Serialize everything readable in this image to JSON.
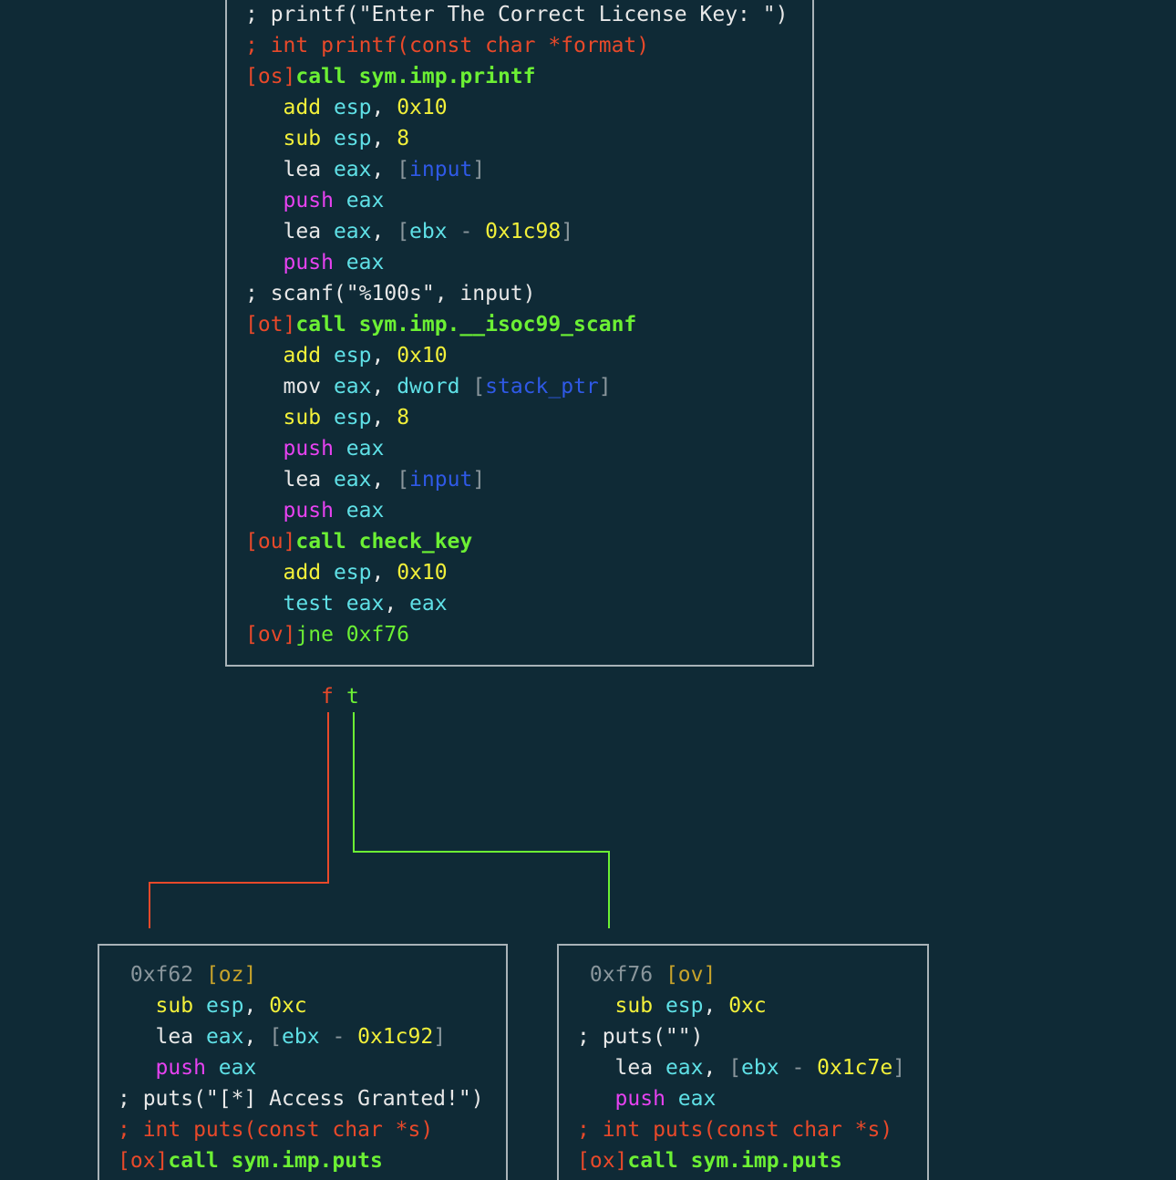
{
  "top_block": {
    "lines": [
      [
        {
          "t": "; printf(\"Enter The Correct License Key: \")",
          "c": "white"
        }
      ],
      [
        {
          "t": "; int printf(const char *format)",
          "c": "red"
        }
      ],
      [
        {
          "t": "[os]",
          "c": "red"
        },
        {
          "t": "call sym.imp.printf",
          "c": "green",
          "b": true
        }
      ],
      [
        {
          "t": "   add ",
          "c": "yellow"
        },
        {
          "t": "esp",
          "c": "cyan"
        },
        {
          "t": ", ",
          "c": "white"
        },
        {
          "t": "0x10",
          "c": "yellow"
        }
      ],
      [
        {
          "t": "   sub ",
          "c": "yellow"
        },
        {
          "t": "esp",
          "c": "cyan"
        },
        {
          "t": ", ",
          "c": "white"
        },
        {
          "t": "8",
          "c": "yellow"
        }
      ],
      [
        {
          "t": "   lea ",
          "c": "white"
        },
        {
          "t": "eax",
          "c": "cyan"
        },
        {
          "t": ", ",
          "c": "white"
        },
        {
          "t": "[",
          "c": "gray"
        },
        {
          "t": "input",
          "c": "blue"
        },
        {
          "t": "]",
          "c": "gray"
        }
      ],
      [
        {
          "t": "   push ",
          "c": "magenta"
        },
        {
          "t": "eax",
          "c": "cyan"
        }
      ],
      [
        {
          "t": "   lea ",
          "c": "white"
        },
        {
          "t": "eax",
          "c": "cyan"
        },
        {
          "t": ", ",
          "c": "white"
        },
        {
          "t": "[",
          "c": "gray"
        },
        {
          "t": "ebx",
          "c": "cyan"
        },
        {
          "t": " - ",
          "c": "gray"
        },
        {
          "t": "0x1c98",
          "c": "yellow"
        },
        {
          "t": "]",
          "c": "gray"
        }
      ],
      [
        {
          "t": "   push ",
          "c": "magenta"
        },
        {
          "t": "eax",
          "c": "cyan"
        }
      ],
      [
        {
          "t": "; scanf(\"%100s\", input)",
          "c": "white"
        }
      ],
      [
        {
          "t": "[ot]",
          "c": "red"
        },
        {
          "t": "call sym.imp.__isoc99_scanf",
          "c": "green",
          "b": true
        }
      ],
      [
        {
          "t": "   add ",
          "c": "yellow"
        },
        {
          "t": "esp",
          "c": "cyan"
        },
        {
          "t": ", ",
          "c": "white"
        },
        {
          "t": "0x10",
          "c": "yellow"
        }
      ],
      [
        {
          "t": "   mov ",
          "c": "white"
        },
        {
          "t": "eax",
          "c": "cyan"
        },
        {
          "t": ", ",
          "c": "white"
        },
        {
          "t": "dword ",
          "c": "cyan"
        },
        {
          "t": "[",
          "c": "gray"
        },
        {
          "t": "stack_ptr",
          "c": "blue"
        },
        {
          "t": "]",
          "c": "gray"
        }
      ],
      [
        {
          "t": "   sub ",
          "c": "yellow"
        },
        {
          "t": "esp",
          "c": "cyan"
        },
        {
          "t": ", ",
          "c": "white"
        },
        {
          "t": "8",
          "c": "yellow"
        }
      ],
      [
        {
          "t": "   push ",
          "c": "magenta"
        },
        {
          "t": "eax",
          "c": "cyan"
        }
      ],
      [
        {
          "t": "   lea ",
          "c": "white"
        },
        {
          "t": "eax",
          "c": "cyan"
        },
        {
          "t": ", ",
          "c": "white"
        },
        {
          "t": "[",
          "c": "gray"
        },
        {
          "t": "input",
          "c": "blue"
        },
        {
          "t": "]",
          "c": "gray"
        }
      ],
      [
        {
          "t": "   push ",
          "c": "magenta"
        },
        {
          "t": "eax",
          "c": "cyan"
        }
      ],
      [
        {
          "t": "[ou]",
          "c": "red"
        },
        {
          "t": "call check_key",
          "c": "green",
          "b": true
        }
      ],
      [
        {
          "t": "   add ",
          "c": "yellow"
        },
        {
          "t": "esp",
          "c": "cyan"
        },
        {
          "t": ", ",
          "c": "white"
        },
        {
          "t": "0x10",
          "c": "yellow"
        }
      ],
      [
        {
          "t": "   test ",
          "c": "cyan"
        },
        {
          "t": "eax",
          "c": "cyan"
        },
        {
          "t": ", ",
          "c": "white"
        },
        {
          "t": "eax",
          "c": "cyan"
        }
      ],
      [
        {
          "t": "[ov]",
          "c": "red"
        },
        {
          "t": "jne 0xf76",
          "c": "green"
        }
      ]
    ]
  },
  "edge_labels": {
    "false_label": "f",
    "true_label": "t"
  },
  "left_block": {
    "lines": [
      [
        {
          "t": " 0xf62 ",
          "c": "gray"
        },
        {
          "t": "[oz]",
          "c": "gold"
        }
      ],
      [
        {
          "t": "   sub ",
          "c": "yellow"
        },
        {
          "t": "esp",
          "c": "cyan"
        },
        {
          "t": ", ",
          "c": "white"
        },
        {
          "t": "0xc",
          "c": "yellow"
        }
      ],
      [
        {
          "t": "   lea ",
          "c": "white"
        },
        {
          "t": "eax",
          "c": "cyan"
        },
        {
          "t": ", ",
          "c": "white"
        },
        {
          "t": "[",
          "c": "gray"
        },
        {
          "t": "ebx",
          "c": "cyan"
        },
        {
          "t": " - ",
          "c": "gray"
        },
        {
          "t": "0x1c92",
          "c": "yellow"
        },
        {
          "t": "]",
          "c": "gray"
        }
      ],
      [
        {
          "t": "   push ",
          "c": "magenta"
        },
        {
          "t": "eax",
          "c": "cyan"
        }
      ],
      [
        {
          "t": "; puts(\"[*] Access Granted!\")",
          "c": "white"
        }
      ],
      [
        {
          "t": "; int puts(const char *s)",
          "c": "red"
        }
      ],
      [
        {
          "t": "[ox]",
          "c": "red"
        },
        {
          "t": "call sym.imp.puts",
          "c": "green",
          "b": true
        }
      ]
    ]
  },
  "right_block": {
    "lines": [
      [
        {
          "t": " 0xf76 ",
          "c": "gray"
        },
        {
          "t": "[ov]",
          "c": "gold"
        }
      ],
      [
        {
          "t": "   sub ",
          "c": "yellow"
        },
        {
          "t": "esp",
          "c": "cyan"
        },
        {
          "t": ", ",
          "c": "white"
        },
        {
          "t": "0xc",
          "c": "yellow"
        }
      ],
      [
        {
          "t": "; puts(\"\")",
          "c": "white"
        }
      ],
      [
        {
          "t": "   lea ",
          "c": "white"
        },
        {
          "t": "eax",
          "c": "cyan"
        },
        {
          "t": ", ",
          "c": "white"
        },
        {
          "t": "[",
          "c": "gray"
        },
        {
          "t": "ebx",
          "c": "cyan"
        },
        {
          "t": " - ",
          "c": "gray"
        },
        {
          "t": "0x1c7e",
          "c": "yellow"
        },
        {
          "t": "]",
          "c": "gray"
        }
      ],
      [
        {
          "t": "   push ",
          "c": "magenta"
        },
        {
          "t": "eax",
          "c": "cyan"
        }
      ],
      [
        {
          "t": "; int puts(const char *s)",
          "c": "red"
        }
      ],
      [
        {
          "t": "[ox]",
          "c": "red"
        },
        {
          "t": "call sym.imp.puts",
          "c": "green",
          "b": true
        }
      ]
    ]
  },
  "colors": {
    "background": "#0f2a36",
    "false_edge": "#e8492a",
    "true_edge": "#6cf034",
    "border": "#a9b3b8"
  }
}
